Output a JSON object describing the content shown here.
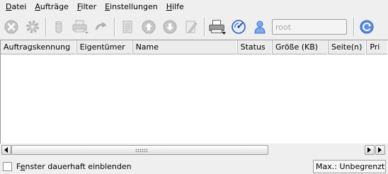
{
  "menubar": {
    "items": [
      {
        "pre": "",
        "ul": "D",
        "post": "atei"
      },
      {
        "pre": "",
        "ul": "A",
        "post": "ufträge"
      },
      {
        "pre": "",
        "ul": "F",
        "post": "ilter"
      },
      {
        "pre": "",
        "ul": "E",
        "post": "instellungen"
      },
      {
        "pre": "",
        "ul": "H",
        "post": "ilfe"
      }
    ]
  },
  "toolbar": {
    "icons": [
      "cancel-job-icon",
      "settings-gear-icon",
      "hold-cylinder-icon",
      "printer-disabled-icon",
      "redo-arrow-icon",
      "job-list-icon",
      "move-up-icon",
      "move-down-icon",
      "edit-icon",
      "printer-icon",
      "dial-icon",
      "user-icon",
      "refresh-icon"
    ],
    "user_filter_value": "root"
  },
  "table": {
    "columns": [
      "Auftragskennung",
      "Eigentümer",
      "Name",
      "Status",
      "Größe (KB)",
      "Seite(n)",
      "Pri"
    ],
    "rows": []
  },
  "statusbar": {
    "checkbox_label_pre": "F",
    "checkbox_label_ul": "e",
    "checkbox_label_post": "nster dauerhaft einblenden",
    "checkbox_checked": false,
    "max_label": "Max.: Unbegrenzt"
  },
  "colors": {
    "background": "#efefef",
    "accent_blue": "#3a6fd8",
    "disabled_gray": "#b4b4b4"
  }
}
